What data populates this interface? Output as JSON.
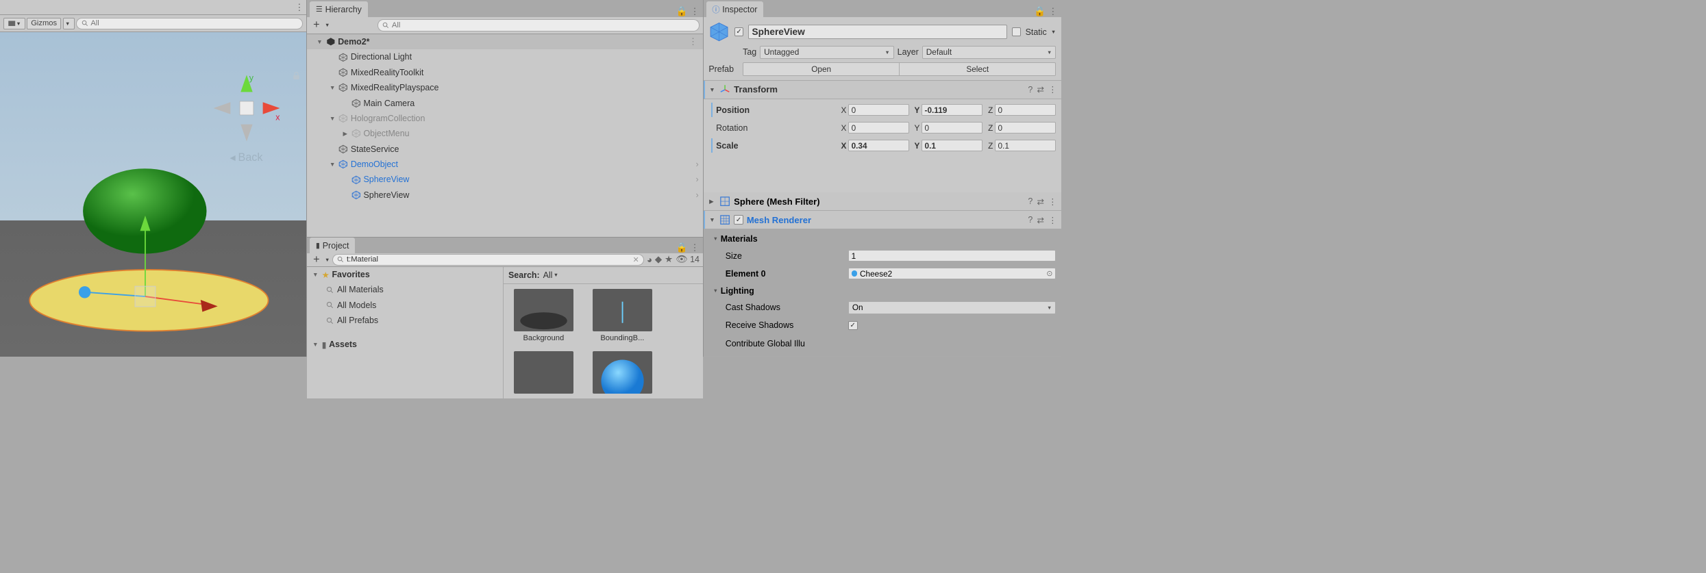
{
  "scene": {
    "gizmos_label": "Gizmos",
    "search_placeholder": "All",
    "axis_x": "x",
    "axis_y": "y",
    "back_label": "Back"
  },
  "hierarchy": {
    "tab_label": "Hierarchy",
    "search_placeholder": "All",
    "items": [
      {
        "label": "Demo2*",
        "depth": 0,
        "scene": true,
        "bold": true,
        "fold": "▼"
      },
      {
        "label": "Directional Light",
        "depth": 1
      },
      {
        "label": "MixedRealityToolkit",
        "depth": 1
      },
      {
        "label": "MixedRealityPlayspace",
        "depth": 1,
        "fold": "▼"
      },
      {
        "label": "Main Camera",
        "depth": 2
      },
      {
        "label": "HologramCollection",
        "depth": 1,
        "fold": "▼",
        "dim": true
      },
      {
        "label": "ObjectMenu",
        "depth": 2,
        "fold": "▶",
        "dim": true
      },
      {
        "label": "StateService",
        "depth": 1
      },
      {
        "label": "DemoObject",
        "depth": 1,
        "fold": "▼",
        "blue": true,
        "arrow": true
      },
      {
        "label": "SphereView",
        "depth": 2,
        "blue": true,
        "arrow": true,
        "prefab": true
      },
      {
        "label": "SphereView",
        "depth": 2,
        "arrow": true,
        "prefab": true
      }
    ]
  },
  "project": {
    "tab_label": "Project",
    "search_value": "t:Material",
    "hidden_count": "14",
    "search_label": "Search:",
    "search_scope": "All",
    "favorites_label": "Favorites",
    "fav_items": [
      "All Materials",
      "All Models",
      "All Prefabs"
    ],
    "assets_label": "Assets",
    "items": [
      {
        "label": "Background"
      },
      {
        "label": "BoundingB..."
      }
    ]
  },
  "inspector": {
    "tab_label": "Inspector",
    "name": "SphereView",
    "static_label": "Static",
    "tag_label": "Tag",
    "tag_value": "Untagged",
    "layer_label": "Layer",
    "layer_value": "Default",
    "prefab_label": "Prefab",
    "open_label": "Open",
    "select_label": "Select",
    "transform": {
      "title": "Transform",
      "position_label": "Position",
      "rotation_label": "Rotation",
      "scale_label": "Scale",
      "position": {
        "x": "0",
        "y": "-0.119",
        "z": "0"
      },
      "rotation": {
        "x": "0",
        "y": "0",
        "z": "0"
      },
      "scale": {
        "x": "0.34",
        "y": "0.1",
        "z": "0.1"
      }
    },
    "mesh_filter": {
      "title": "Sphere (Mesh Filter)"
    },
    "mesh_renderer": {
      "title": "Mesh Renderer",
      "materials_label": "Materials",
      "size_label": "Size",
      "size_value": "1",
      "element0_label": "Element 0",
      "element0_value": "Cheese2",
      "lighting_label": "Lighting",
      "cast_shadows_label": "Cast Shadows",
      "cast_shadows_value": "On",
      "receive_shadows_label": "Receive Shadows",
      "contribute_gi_label": "Contribute Global Illu"
    }
  }
}
